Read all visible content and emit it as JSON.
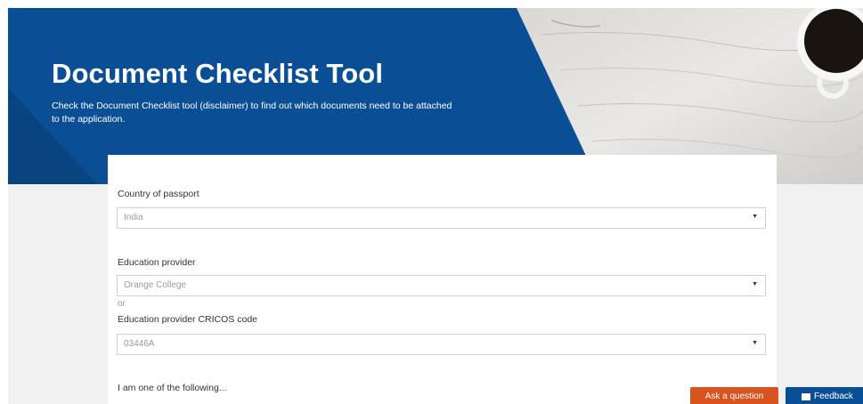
{
  "hero": {
    "title": "Document Checklist Tool",
    "description": "Check the Document Checklist tool (disclaimer) to find out which documents need to be attached to the application."
  },
  "form": {
    "passport": {
      "label": "Country of passport",
      "value": "India"
    },
    "provider": {
      "label": "Education provider",
      "value": "Orange College"
    },
    "or_text": "or",
    "cricos": {
      "label": "Education provider CRICOS code",
      "value": "03446A"
    },
    "next_label": "I am one of the following..."
  },
  "buttons": {
    "ask_label": "Ask a question",
    "feedback_label": "Feedback"
  },
  "colors": {
    "brand_blue": "#0a4f95",
    "ask_orange": "#d9531e",
    "page_gray": "#f1f1f1"
  },
  "icons": {
    "caret": "caret-down-icon",
    "feedback": "feedback-chat-icon"
  }
}
